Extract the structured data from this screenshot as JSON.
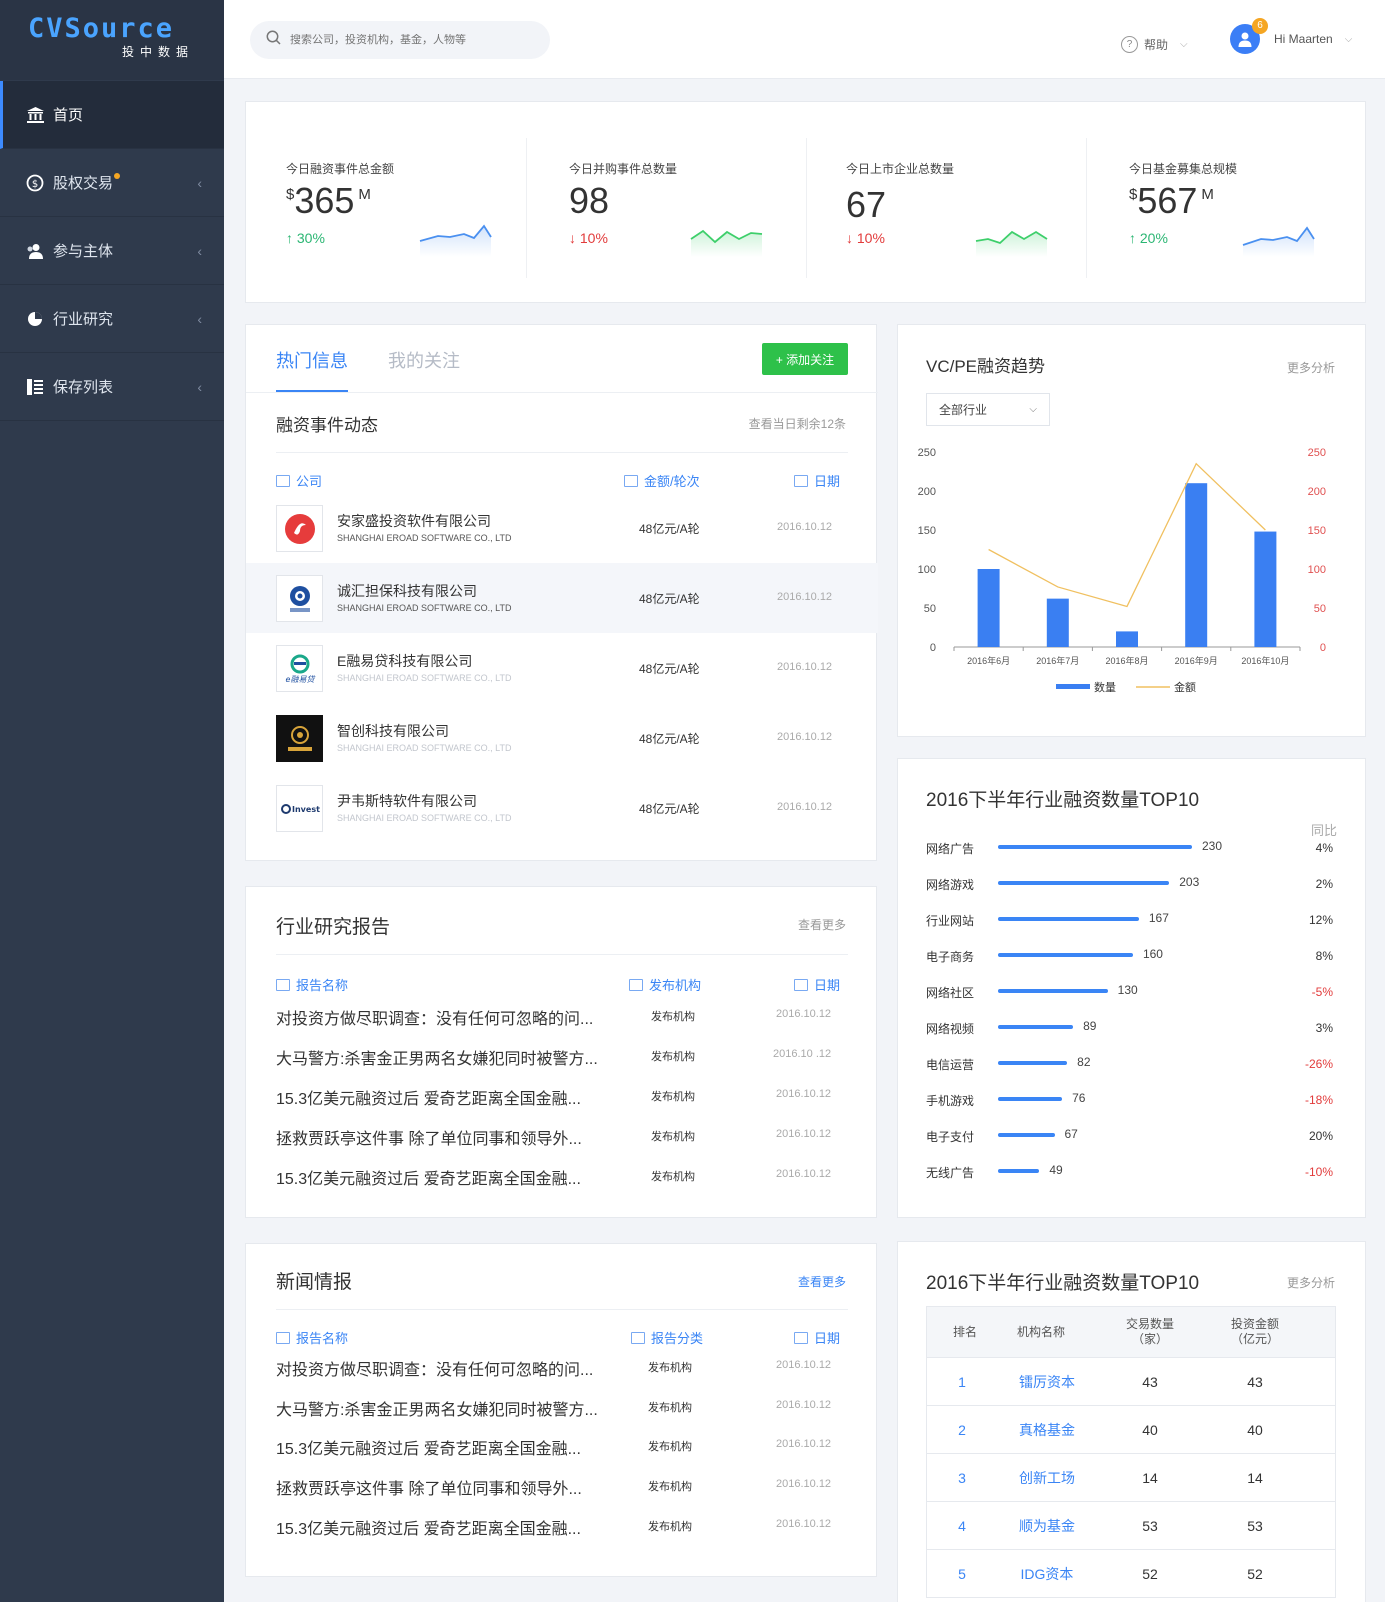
{
  "logo": {
    "text": "CVSource",
    "sub": "投中数据"
  },
  "sidebar": {
    "items": [
      {
        "label": "首页",
        "icon": "bank-icon"
      },
      {
        "label": "股权交易",
        "icon": "money-icon"
      },
      {
        "label": "参与主体",
        "icon": "users-icon"
      },
      {
        "label": "行业研究",
        "icon": "pie-chart-icon"
      },
      {
        "label": "保存列表",
        "icon": "list-icon"
      }
    ]
  },
  "topbar": {
    "search_placeholder": "搜索公司，投资机构，基金，人物等",
    "help": "帮助",
    "user": "Hi Maarten",
    "badge": "6"
  },
  "stats": [
    {
      "label": "今日融资事件总金额",
      "prefix": "$",
      "value": "365",
      "unit": "M",
      "change": "30%",
      "direction": "up",
      "spark_color": "#4a90f0"
    },
    {
      "label": "今日并购事件总数量",
      "prefix": "",
      "value": "98",
      "unit": "",
      "change": "10%",
      "direction": "down",
      "spark_color": "#3ecf6b"
    },
    {
      "label": "今日上市企业总数量",
      "prefix": "",
      "value": "67",
      "unit": "",
      "change": "10%",
      "direction": "down",
      "spark_color": "#3ecf6b"
    },
    {
      "label": "今日基金募集总规模",
      "prefix": "$",
      "value": "567",
      "unit": "M",
      "change": "20%",
      "direction": "up",
      "spark_color": "#4a90f0"
    }
  ],
  "hot": {
    "tab_active": "热门信息",
    "tab_inactive": "我的关注",
    "add_button": "+ 添加关注",
    "section_title": "融资事件动态",
    "more": "查看当日剩余12条",
    "columns": {
      "company": "公司",
      "amount": "金额/轮次",
      "date": "日期"
    },
    "rows": [
      {
        "name": "安家盛投资软件有限公司",
        "sub": "SHANGHAI EROAD SOFTWARE CO., LTD",
        "amount": "48亿元/A轮",
        "date": "2016.10.12"
      },
      {
        "name": "诚汇担保科技有限公司",
        "sub": "SHANGHAI EROAD SOFTWARE CO., LTD",
        "amount": "48亿元/A轮",
        "date": "2016.10.12"
      },
      {
        "name": "E融易贷科技有限公司",
        "sub": "SHANGHAI EROAD SOFTWARE CO., LTD",
        "amount": "48亿元/A轮",
        "date": "2016.10.12"
      },
      {
        "name": "智创科技有限公司",
        "sub": "SHANGHAI EROAD SOFTWARE CO., LTD",
        "amount": "48亿元/A轮",
        "date": "2016.10.12"
      },
      {
        "name": "尹韦斯特软件有限公司",
        "sub": "SHANGHAI EROAD SOFTWARE CO., LTD",
        "amount": "48亿元/A轮",
        "date": "2016.10.12"
      }
    ]
  },
  "report": {
    "title": "行业研究报告",
    "more": "查看更多",
    "columns": {
      "name": "报告名称",
      "org": "发布机构",
      "date": "日期"
    },
    "rows": [
      {
        "title": "对投资方做尽职调查：没有任何可忽略的问...",
        "org": "发布机构",
        "date": "2016.10.12"
      },
      {
        "title": "大马警方:杀害金正男两名女嫌犯同时被警方...",
        "org": "发布机构",
        "date": "2016.10 .12"
      },
      {
        "title": "15.3亿美元融资过后 爱奇艺距离全国金融...",
        "org": "发布机构",
        "date": "2016.10.12"
      },
      {
        "title": "拯救贾跃亭这件事 除了单位同事和领导外...",
        "org": "发布机构",
        "date": "2016.10.12"
      },
      {
        "title": "15.3亿美元融资过后 爱奇艺距离全国金融...",
        "org": "发布机构",
        "date": "2016.10.12"
      }
    ]
  },
  "news": {
    "title": "新闻情报",
    "more": "查看更多",
    "columns": {
      "name": "报告名称",
      "category": "报告分类",
      "date": "日期"
    },
    "rows": [
      {
        "title": "对投资方做尽职调查：没有任何可忽略的问...",
        "org": "发布机构",
        "date": "2016.10.12"
      },
      {
        "title": "大马警方:杀害金正男两名女嫌犯同时被警方...",
        "org": "发布机构",
        "date": "2016.10.12"
      },
      {
        "title": "15.3亿美元融资过后 爱奇艺距离全国金融...",
        "org": "发布机构",
        "date": "2016.10.12"
      },
      {
        "title": "拯救贾跃亭这件事 除了单位同事和领导外...",
        "org": "发布机构",
        "date": "2016.10.12"
      },
      {
        "title": "15.3亿美元融资过后 爱奇艺距离全国金融...",
        "org": "发布机构",
        "date": "2016.10.12"
      }
    ]
  },
  "vcpe": {
    "title": "VC/PE融资趋势",
    "more": "更多分析",
    "select": "全部行业"
  },
  "top10": {
    "title": "2016下半年行业融资数量TOP10",
    "yoy_label": "同比"
  },
  "rank": {
    "title": "2016下半年行业融资数量TOP10",
    "more": "更多分析",
    "headers": {
      "rank": "排名",
      "org": "机构名称",
      "count": "交易数量\n（家）",
      "amount": "投资金额\n（亿元）"
    },
    "rows": [
      {
        "rank": "1",
        "org": "镭厉资本",
        "count": "43",
        "amount": "43"
      },
      {
        "rank": "2",
        "org": "真格基金",
        "count": "40",
        "amount": "40"
      },
      {
        "rank": "3",
        "org": "创新工场",
        "count": "14",
        "amount": "14"
      },
      {
        "rank": "4",
        "org": "顺为基金",
        "count": "53",
        "amount": "53"
      },
      {
        "rank": "5",
        "org": "IDG资本",
        "count": "52",
        "amount": "52"
      }
    ]
  },
  "chart_data": [
    {
      "type": "bar",
      "title": "VC/PE融资趋势",
      "categories": [
        "2016年6月",
        "2016年7月",
        "2016年8月",
        "2016年9月",
        "2016年10月"
      ],
      "series": [
        {
          "name": "数量",
          "type": "bar",
          "values": [
            100,
            62,
            20,
            210,
            148
          ],
          "color": "#3a7ff2",
          "axis": "left"
        },
        {
          "name": "金额",
          "type": "line",
          "values": [
            125,
            77,
            52,
            235,
            150
          ],
          "color": "#f0c060",
          "axis": "right"
        }
      ],
      "ylim_left": [
        0,
        250
      ],
      "ylim_right": [
        0,
        250
      ],
      "yticks": [
        0,
        50,
        100,
        150,
        200,
        250
      ],
      "legend": "bottom",
      "grid": false
    },
    {
      "type": "bar",
      "orientation": "horizontal",
      "title": "2016下半年行业融资数量TOP10",
      "categories": [
        "网络广告",
        "网络游戏",
        "行业网站",
        "电子商务",
        "网络社区",
        "网络视频",
        "电信运营",
        "手机游戏",
        "电子支付",
        "无线广告"
      ],
      "values": [
        230,
        203,
        167,
        160,
        130,
        89,
        82,
        76,
        67,
        49
      ],
      "yoy": [
        "4%",
        "2%",
        "12%",
        "8%",
        "-5%",
        "3%",
        "-26%",
        "-18%",
        "20%",
        "-10%"
      ],
      "color": "#3a85f5"
    }
  ]
}
